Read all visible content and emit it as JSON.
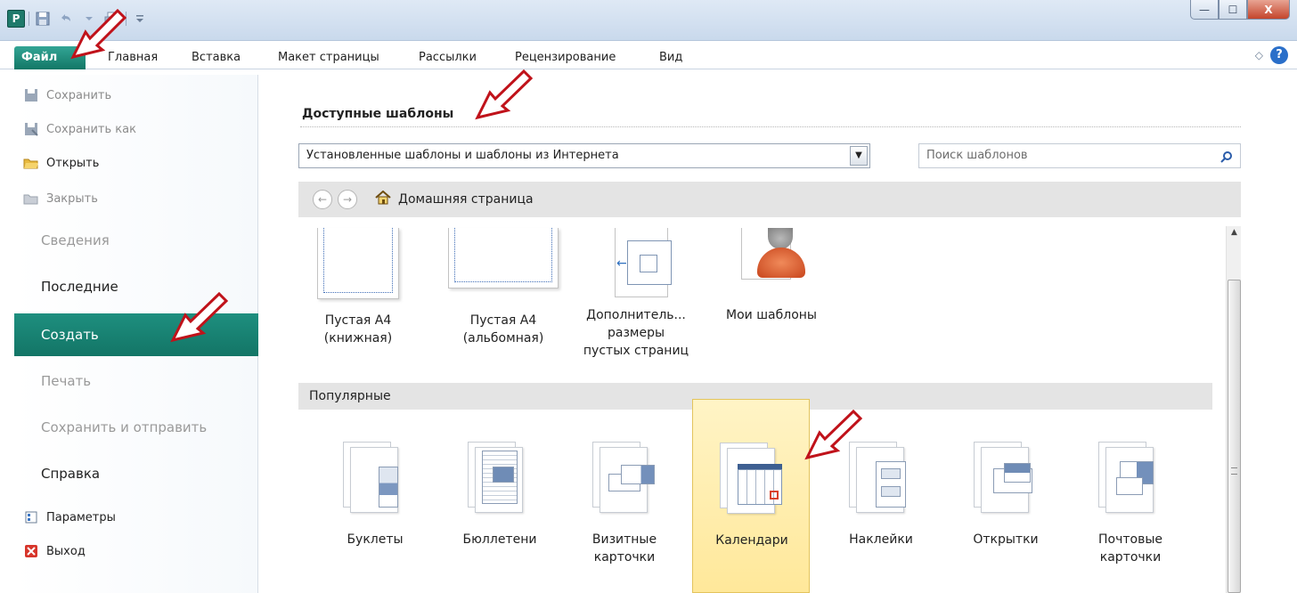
{
  "app": {
    "icon_letter": "P"
  },
  "window": {
    "minimize_glyph": "—",
    "maximize_glyph": "☐",
    "close_glyph": "X"
  },
  "ribbon": {
    "tabs": [
      {
        "label": "Файл"
      },
      {
        "label": "Главная"
      },
      {
        "label": "Вставка"
      },
      {
        "label": "Макет страницы"
      },
      {
        "label": "Рассылки"
      },
      {
        "label": "Рецензирование"
      },
      {
        "label": "Вид"
      }
    ],
    "help_glyph": "?"
  },
  "backstage": {
    "commands": [
      {
        "label": "Сохранить",
        "icon": "save-icon",
        "enabled": false
      },
      {
        "label": "Сохранить как",
        "icon": "save-as-icon",
        "enabled": false
      },
      {
        "label": "Открыть",
        "icon": "open-folder-icon",
        "enabled": true
      },
      {
        "label": "Закрыть",
        "icon": "close-document-icon",
        "enabled": false
      }
    ],
    "items": [
      {
        "label": "Сведения",
        "enabled": false
      },
      {
        "label": "Последние",
        "enabled": true
      },
      {
        "label": "Создать",
        "enabled": true,
        "active": true
      },
      {
        "label": "Печать",
        "enabled": false
      },
      {
        "label": "Сохранить и отправить",
        "enabled": false
      },
      {
        "label": "Справка",
        "enabled": true
      }
    ],
    "bottom_commands": [
      {
        "label": "Параметры",
        "icon": "options-icon"
      },
      {
        "label": "Выход",
        "icon": "exit-icon"
      }
    ]
  },
  "templates": {
    "section_title": "Доступные шаблоны",
    "source_select": "Установленные шаблоны и шаблоны из Интернета",
    "search_placeholder": "Поиск шаблонов",
    "home_label": "Домашняя страница",
    "top_items": [
      {
        "line1": "Пустая A4",
        "line2": "(книжная)",
        "line3": ""
      },
      {
        "line1": "Пустая A4",
        "line2": "(альбомная)",
        "line3": ""
      },
      {
        "line1": "Дополнитель...",
        "line2": "размеры",
        "line3": "пустых страниц"
      },
      {
        "line1": "Мои шаблоны",
        "line2": "",
        "line3": ""
      }
    ],
    "popular_title": "Популярные",
    "popular": [
      {
        "line1": "Буклеты",
        "line2": ""
      },
      {
        "line1": "Бюллетени",
        "line2": ""
      },
      {
        "line1": "Визитные",
        "line2": "карточки"
      },
      {
        "line1": "Календари",
        "line2": "",
        "selected": true
      },
      {
        "line1": "Наклейки",
        "line2": ""
      },
      {
        "line1": "Открытки",
        "line2": ""
      },
      {
        "line1": "Почтовые",
        "line2": "карточки"
      }
    ]
  },
  "colors": {
    "accent": "#137566",
    "annotation": "#c0121a",
    "selection": "#ffe89a"
  }
}
